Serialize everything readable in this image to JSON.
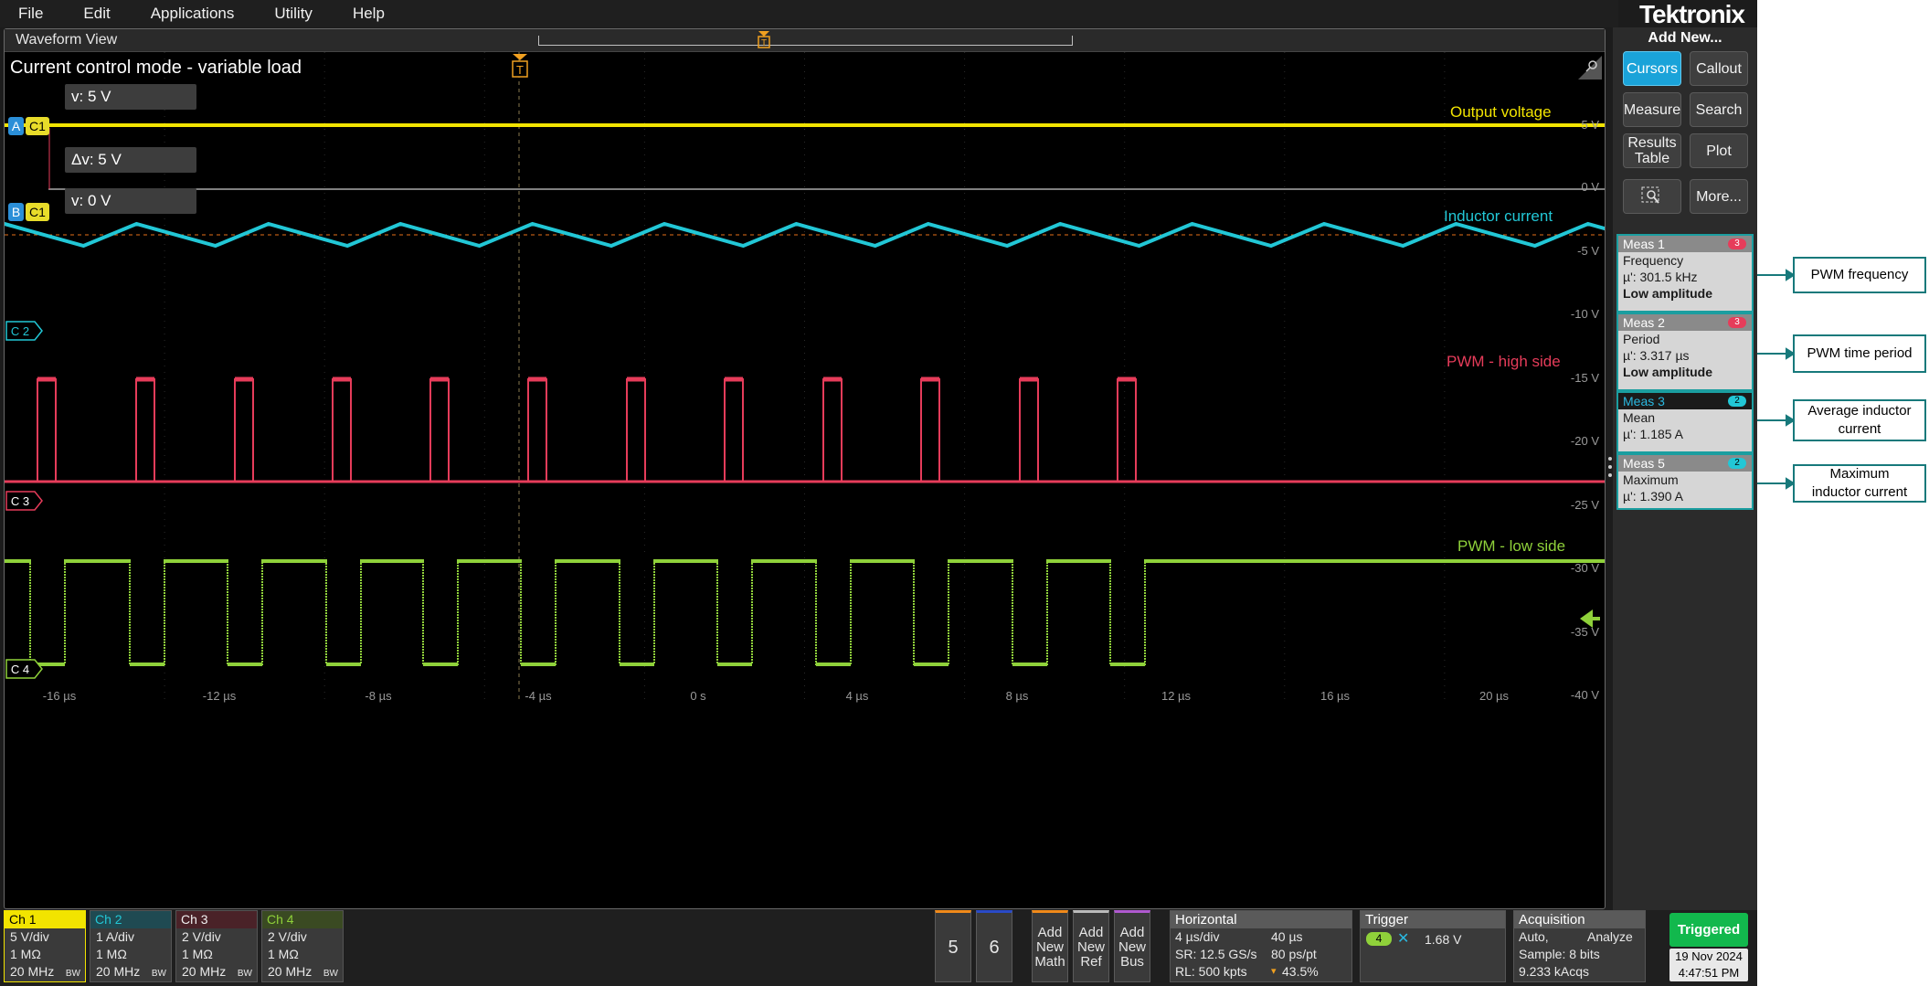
{
  "menu": [
    "File",
    "Edit",
    "Applications",
    "Utility",
    "Help"
  ],
  "brand": "Tektronix",
  "waveform_view": {
    "title": "Waveform View",
    "plot_title": "Current control mode - variable load"
  },
  "traces": {
    "output_voltage": "Output voltage",
    "inductor_current": "Inductor current",
    "pwm_high": "PWM - high side",
    "pwm_low": "PWM - low side"
  },
  "cursor": {
    "a_label": "A",
    "b_label": "B",
    "ch_label": "C1",
    "v_a": "v: 5 V",
    "delta_v": "Δv: 5 V",
    "v_b": "v: 0 V"
  },
  "channel_markers": [
    "C 2",
    "C 3",
    "C 4"
  ],
  "trigger_marker": "T",
  "y_ticks": [
    "5 V",
    "0 V",
    "-5 V",
    "-10 V",
    "-15 V",
    "-20 V",
    "-25 V",
    "-30 V",
    "-35 V",
    "-40 V"
  ],
  "x_ticks": [
    "-16 µs",
    "-12 µs",
    "-8 µs",
    "-4 µs",
    "0 s",
    "4 µs",
    "8 µs",
    "12 µs",
    "16 µs",
    "20 µs"
  ],
  "panel": {
    "title": "Add New...",
    "buttons": [
      "Cursors",
      "Callout",
      "Measure",
      "Search",
      "Results Table",
      "Plot",
      "More..."
    ]
  },
  "measurements": [
    {
      "name": "Meas 1",
      "badge": "3",
      "type": "Frequency",
      "value": "µ': 301.5 kHz",
      "note": "Low amplitude"
    },
    {
      "name": "Meas 2",
      "badge": "3",
      "type": "Period",
      "value": "µ': 3.317 µs",
      "note": "Low amplitude"
    },
    {
      "name": "Meas 3",
      "badge": "2",
      "type": "Mean",
      "value": "µ': 1.185 A"
    },
    {
      "name": "Meas 5",
      "badge": "2",
      "type": "Maximum",
      "value": "µ': 1.390 A"
    }
  ],
  "annotations": [
    "PWM frequency",
    "PWM time period",
    "Average inductor current",
    "Maximum inductor current"
  ],
  "channels": [
    {
      "name": "Ch 1",
      "scale": "5 V/div",
      "imp": "1 MΩ",
      "bw": "20 MHz",
      "bw_tag": "BW",
      "color": "#f2e400"
    },
    {
      "name": "Ch 2",
      "scale": "1 A/div",
      "imp": "1 MΩ",
      "bw": "20 MHz",
      "bw_tag": "BW",
      "color": "#22c7d6"
    },
    {
      "name": "Ch 3",
      "scale": "2 V/div",
      "imp": "1 MΩ",
      "bw": "20 MHz",
      "bw_tag": "BW",
      "color": "#e63c5a"
    },
    {
      "name": "Ch 4",
      "scale": "2 V/div",
      "imp": "1 MΩ",
      "bw": "20 MHz",
      "bw_tag": "BW",
      "color": "#8fd13a"
    }
  ],
  "number_buttons": [
    "5",
    "6"
  ],
  "add_buttons": [
    {
      "line1": "Add",
      "line2": "New",
      "line3": "Math"
    },
    {
      "line1": "Add",
      "line2": "New",
      "line3": "Ref"
    },
    {
      "line1": "Add",
      "line2": "New",
      "line3": "Bus"
    }
  ],
  "horizontal": {
    "title": "Horizontal",
    "scale": "4 µs/div",
    "duration": "40 µs",
    "sample_rate": "SR: 12.5 GS/s",
    "resolution": "80 ps/pt",
    "record_length": "RL: 500 kpts",
    "position": "43.5%"
  },
  "trigger": {
    "title": "Trigger",
    "source": "4",
    "level": "1.68 V"
  },
  "acquisition": {
    "title": "Acquisition",
    "mode": "Auto,",
    "action": "Analyze",
    "bits": "Sample: 8 bits",
    "acqs": "9.233 kAcqs"
  },
  "status": {
    "state": "Triggered",
    "date": "19 Nov 2024",
    "time": "4:47:51 PM"
  }
}
